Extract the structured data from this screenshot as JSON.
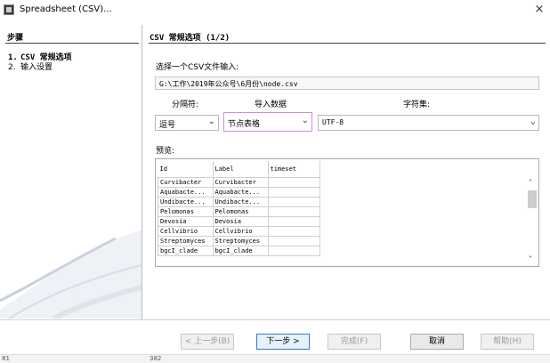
{
  "window": {
    "title": "Spreadsheet (CSV)...",
    "close_glyph": "×"
  },
  "steps": {
    "title": "步骤",
    "items": [
      {
        "num": "1.",
        "label": "CSV 常规选项"
      },
      {
        "num": "2.",
        "label": "输入设置"
      }
    ]
  },
  "main": {
    "section_title": "CSV 常规选项 (1/2)",
    "file_label": "选择一个CSV文件输入:",
    "file_path": "G:\\工作\\2019年公众号\\6月份\\node.csv",
    "separator_label": "分隔符:",
    "import_label": "导入数据",
    "charset_label": "字符集:",
    "separator_value": "逗号",
    "import_value": "节点表格",
    "charset_value": "UTF-8",
    "preview_label": "预览:",
    "preview": {
      "headers": [
        "Id",
        "Label",
        "timeset"
      ],
      "rows": [
        [
          "Curvibacter",
          "Curvibacter",
          ""
        ],
        [
          "Aquabacte...",
          "Aquabacte...",
          ""
        ],
        [
          "Undibacte...",
          "Undibacte...",
          ""
        ],
        [
          "Pelomonas",
          "Pelomonas",
          ""
        ],
        [
          "Devosia",
          "Devosia",
          ""
        ],
        [
          "Cellvibrio",
          "Cellvibrio",
          ""
        ],
        [
          "Streptomyces",
          "Streptomyces",
          ""
        ],
        [
          "bgcI_clade",
          "bgcI_clade",
          ""
        ]
      ]
    }
  },
  "buttons": {
    "back": "< 上一步(B)",
    "next": "下一步 >",
    "finish": "完成(F)",
    "cancel": "取消",
    "help": "帮助(H)"
  },
  "status": {
    "left": "81",
    "mid": "382"
  },
  "colors": {
    "highlight_border": "#d68ad6",
    "primary_border": "#3b78d8"
  },
  "icons": {
    "app": "spreadsheet-app-icon",
    "close": "close-icon",
    "chevron": "chevron-down-icon"
  }
}
